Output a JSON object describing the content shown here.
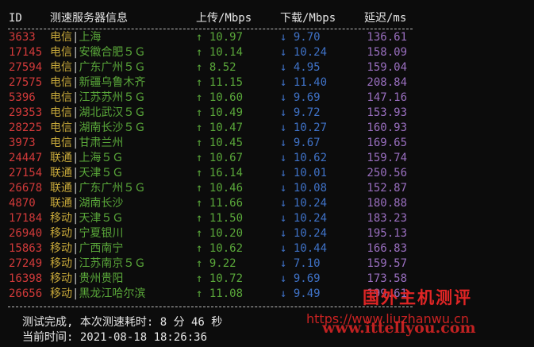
{
  "header": {
    "id": "ID",
    "isp": "测速服务器信息",
    "up": "上传/Mbps",
    "down": "下载/Mbps",
    "latency": "延迟/ms"
  },
  "up_arrow": "↑",
  "down_arrow": "↓",
  "rows": [
    {
      "id": "3633",
      "isp": "电信",
      "city": "上海",
      "up": "10.97",
      "down": "9.70",
      "lat": "136.61"
    },
    {
      "id": "17145",
      "isp": "电信",
      "city": "安徽合肥５Ｇ",
      "up": "10.14",
      "down": "10.24",
      "lat": "158.09"
    },
    {
      "id": "27594",
      "isp": "电信",
      "city": "广东广州５Ｇ",
      "up": "8.52",
      "down": "4.95",
      "lat": "159.04"
    },
    {
      "id": "27575",
      "isp": "电信",
      "city": "新疆乌鲁木齐",
      "up": "11.15",
      "down": "11.40",
      "lat": "208.84"
    },
    {
      "id": "5396",
      "isp": "电信",
      "city": "江苏苏州５Ｇ",
      "up": "10.60",
      "down": "9.69",
      "lat": "147.16"
    },
    {
      "id": "29353",
      "isp": "电信",
      "city": "湖北武汉５Ｇ",
      "up": "10.49",
      "down": "9.72",
      "lat": "153.93"
    },
    {
      "id": "28225",
      "isp": "电信",
      "city": "湖南长沙５Ｇ",
      "up": "10.47",
      "down": "10.27",
      "lat": "160.93"
    },
    {
      "id": "3973",
      "isp": "电信",
      "city": "甘肃兰州",
      "up": "10.45",
      "down": "9.67",
      "lat": "169.65"
    },
    {
      "id": "24447",
      "isp": "联通",
      "city": "上海５Ｇ",
      "up": "10.67",
      "down": "10.62",
      "lat": "159.74"
    },
    {
      "id": "27154",
      "isp": "联通",
      "city": "天津５Ｇ",
      "up": "16.14",
      "down": "10.01",
      "lat": "250.56"
    },
    {
      "id": "26678",
      "isp": "联通",
      "city": "广东广州５Ｇ",
      "up": "10.46",
      "down": "10.08",
      "lat": "152.87"
    },
    {
      "id": "4870",
      "isp": "联通",
      "city": "湖南长沙",
      "up": "11.66",
      "down": "10.24",
      "lat": "180.88"
    },
    {
      "id": "17184",
      "isp": "移动",
      "city": "天津５Ｇ",
      "up": "11.50",
      "down": "10.24",
      "lat": "183.23"
    },
    {
      "id": "26940",
      "isp": "移动",
      "city": "宁夏银川",
      "up": "10.20",
      "down": "10.24",
      "lat": "195.13"
    },
    {
      "id": "15863",
      "isp": "移动",
      "city": "广西南宁",
      "up": "10.62",
      "down": "10.44",
      "lat": "166.83"
    },
    {
      "id": "27249",
      "isp": "移动",
      "city": "江苏南京５Ｇ",
      "up": "9.22",
      "down": "7.10",
      "lat": "159.57"
    },
    {
      "id": "16398",
      "isp": "移动",
      "city": "贵州贵阳",
      "up": "10.72",
      "down": "9.69",
      "lat": "173.58"
    },
    {
      "id": "26656",
      "isp": "移动",
      "city": "黑龙江哈尔滨",
      "up": "11.08",
      "down": "9.49",
      "lat": "199.61"
    }
  ],
  "footer": {
    "done": "测试完成, 本次测速耗时: 8 分 46 秒",
    "time": "当前时间: 2021-08-18 18:26:36"
  },
  "watermark": {
    "title": "国外主机测评",
    "url1": "https://www.liuzhanwu.cn",
    "url2": "www.ittellyou.com"
  }
}
